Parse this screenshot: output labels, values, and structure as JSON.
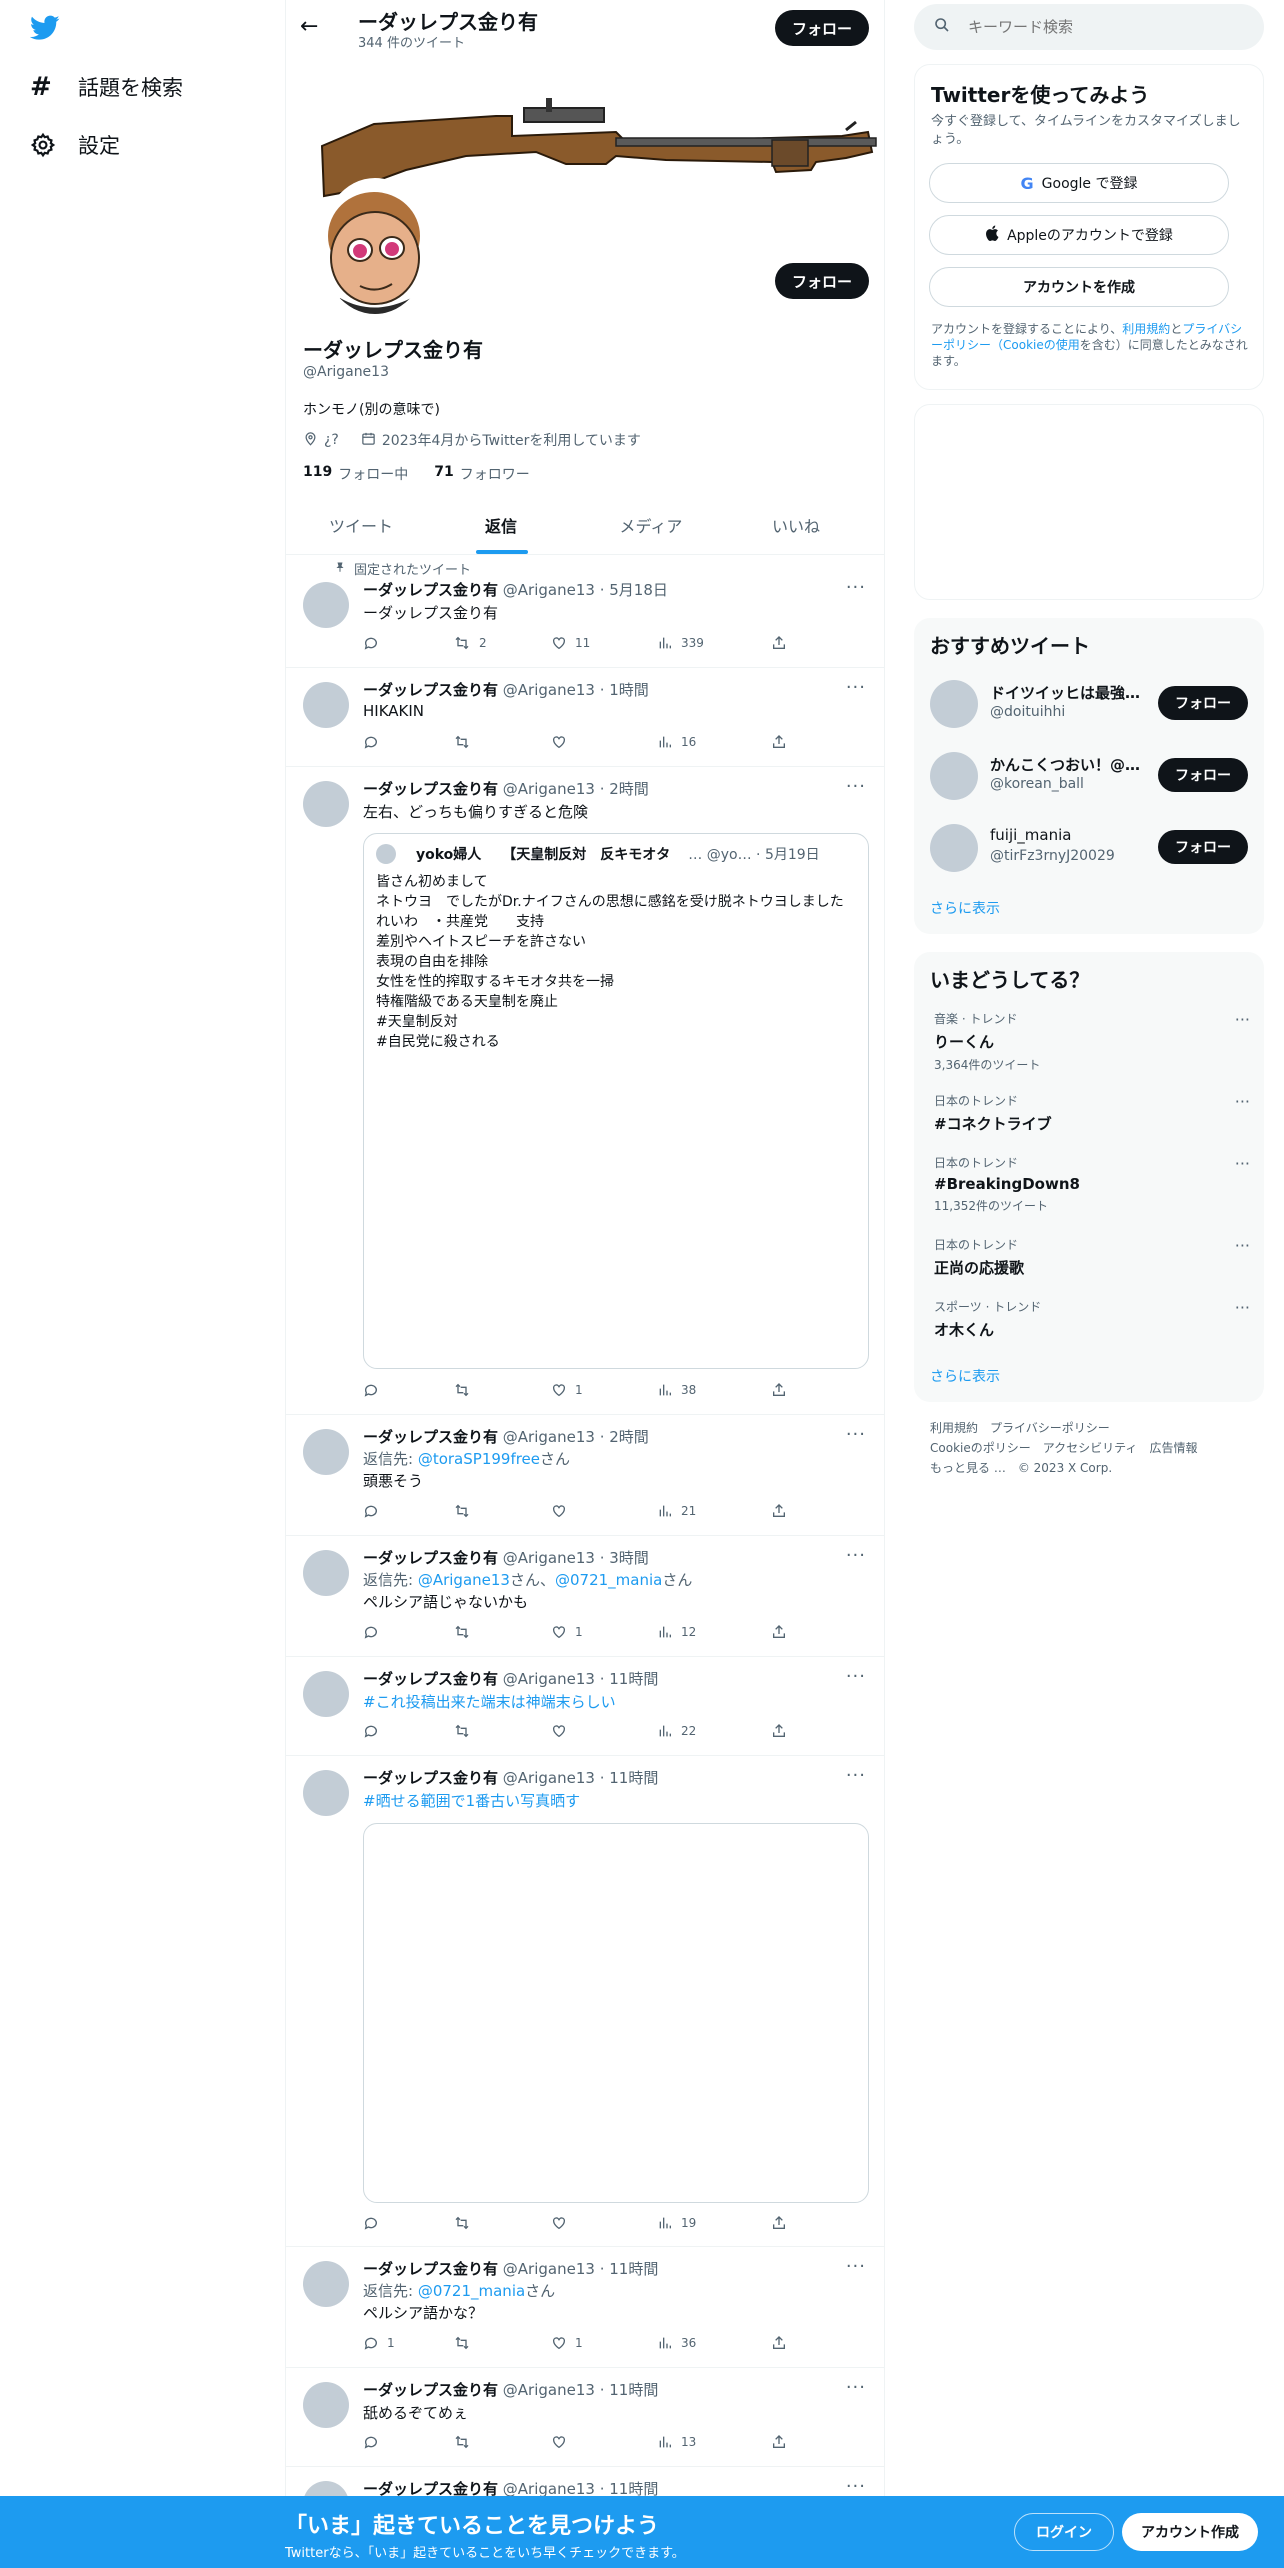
{
  "sidebar": {
    "items": [
      {
        "label": "話題を検索",
        "icon": "hash-icon"
      },
      {
        "label": "設定",
        "icon": "gear-icon"
      }
    ]
  },
  "header": {
    "name": "ーダッレプス金り有",
    "tweet_count": "344 件のツイート",
    "follow": "フォロー"
  },
  "profile": {
    "follow": "フォロー",
    "name": "ーダッレプス金り有",
    "handle": "@Arigane13",
    "bio": "ホンモノ(別の意味で)",
    "location": "¿?",
    "joined": "2023年4月からTwitterを利用しています",
    "following_count": "119",
    "following_label": "フォロー中",
    "followers_count": "71",
    "followers_label": "フォロワー"
  },
  "tabs": [
    "ツイート",
    "返信",
    "メディア",
    "いいね"
  ],
  "pinned_label": "固定されたツイート",
  "tweets": [
    {
      "name": "ーダッレプス金り有",
      "meta": "@Arigane13 · 5月18日",
      "text": "ーダッレプス金り有",
      "replies": "",
      "retweets": "2",
      "likes": "11",
      "views": "339"
    },
    {
      "name": "ーダッレプス金り有",
      "meta": "@Arigane13 · 1時間",
      "text": "HIKAKIN",
      "replies": "",
      "retweets": "",
      "likes": "",
      "views": "16"
    },
    {
      "name": "ーダッレプス金り有",
      "meta": "@Arigane13 · 2時間",
      "text": "左右、どっちも偏りすぎると危険",
      "replies": "",
      "retweets": "",
      "likes": "1",
      "views": "38",
      "quote": {
        "name": "yoko婦人　　【天皇制反対　反キモオタ",
        "meta": "… @yo… · 5月19日",
        "lines": [
          "皆さん初めまして",
          "ネトウヨ　でしたがDr.ナイフさんの思想に感銘を受け脱ネトウヨしました",
          "れいわ　・共産党　　支持",
          "差別やヘイトスピーチを許さない",
          "表現の自由を排除",
          "女性を性的搾取するキモオタ共を一掃",
          "特権階級である天皇制を廃止",
          "#天皇制反対",
          "#自民党に殺される"
        ]
      }
    },
    {
      "name": "ーダッレプス金り有",
      "meta": "@Arigane13 · 2時間",
      "reply_prefix": "返信先: ",
      "reply_to": "@toraSP199free",
      "reply_suffix": "さん",
      "text": "頭悪そう",
      "replies": "",
      "retweets": "",
      "likes": "",
      "views": "21"
    },
    {
      "name": "ーダッレプス金り有",
      "meta": "@Arigane13 · 3時間",
      "reply_prefix": "返信先: ",
      "reply_to": "@Arigane13",
      "reply_mid": "さん、",
      "reply_to2": "@0721_mania",
      "reply_suffix": "さん",
      "text": "ペルシア語じゃないかも",
      "replies": "",
      "retweets": "",
      "likes": "1",
      "views": "12"
    },
    {
      "name": "ーダッレプス金り有",
      "meta": "@Arigane13 · 11時間",
      "hashtag": "#これ投稿出来た端末は神端末らしい",
      "replies": "",
      "retweets": "",
      "likes": "",
      "views": "22"
    },
    {
      "name": "ーダッレプス金り有",
      "meta": "@Arigane13 · 11時間",
      "hashtag": "#晒せる範囲で1番古い写真晒す",
      "replies": "",
      "retweets": "",
      "likes": "",
      "views": "19"
    },
    {
      "name": "ーダッレプス金り有",
      "meta": "@Arigane13 · 11時間",
      "reply_prefix": "返信先: ",
      "reply_to": "@0721_mania",
      "reply_suffix": "さん",
      "text": "ペルシア語かな？",
      "replies": "1",
      "retweets": "",
      "likes": "1",
      "views": "36"
    },
    {
      "name": "ーダッレプス金り有",
      "meta": "@Arigane13 · 11時間",
      "text": "舐めるぞてめぇ",
      "replies": "",
      "retweets": "",
      "likes": "",
      "views": "13"
    },
    {
      "name": "ーダッレプス金り有",
      "meta": "@Arigane13 · 11時間"
    }
  ],
  "search": {
    "placeholder": "キーワード検索"
  },
  "signup": {
    "title": "Twitterを使ってみよう",
    "subtitle": "今すぐ登録して、タイムラインをカスタマイズしましょう。",
    "google": "Google で登録",
    "apple": "Appleのアカウントで登録",
    "create": "アカウントを作成",
    "legal_1": "アカウントを登録することにより、",
    "legal_terms": "利用規約",
    "legal_2": "と",
    "legal_privacy": "プライバシーポリシー（Cookieの使用",
    "legal_3": "を含む）に同意したとみなされます。"
  },
  "recommended": {
    "title": "おすすめツイート",
    "users": [
      {
        "name": "ドイツイッヒは最強…",
        "handle": "@doituihhi",
        "follow": "フォロー"
      },
      {
        "name": "かんこくつおい！@…",
        "handle": "@korean_ball",
        "follow": "フォロー"
      },
      {
        "name": "fuiji_mania",
        "handle": "@tirFz3rnyJ20029",
        "follow": "フォロー"
      }
    ],
    "more": "さらに表示"
  },
  "trends": {
    "title": "いまどうしてる？",
    "items": [
      {
        "context": "音楽 · トレンド",
        "name": "りーくん",
        "count": "3,364件のツイート"
      },
      {
        "context": "日本のトレンド",
        "name": "#コネクトライブ",
        "count": ""
      },
      {
        "context": "日本のトレンド",
        "name": "#BreakingDown8",
        "count": "11,352件のツイート"
      },
      {
        "context": "日本のトレンド",
        "name": "正尚の応援歌",
        "count": ""
      },
      {
        "context": "スポーツ · トレンド",
        "name": "オ木くん",
        "count": ""
      }
    ],
    "more": "さらに表示"
  },
  "footer_links": {
    "line1": [
      "利用規約",
      "プライバシーポリシー"
    ],
    "line2": [
      "Cookieのポリシー",
      "アクセシビリティ",
      "広告情報"
    ],
    "line3": [
      "もっと見る …",
      "© 2023 X Corp."
    ]
  },
  "bottom_bar": {
    "title": "「いま」起きていることを見つけよう",
    "subtitle": "Twitterなら、「いま」起きていることをいち早くチェックできます。",
    "login": "ログイン",
    "signup": "アカウント作成"
  }
}
